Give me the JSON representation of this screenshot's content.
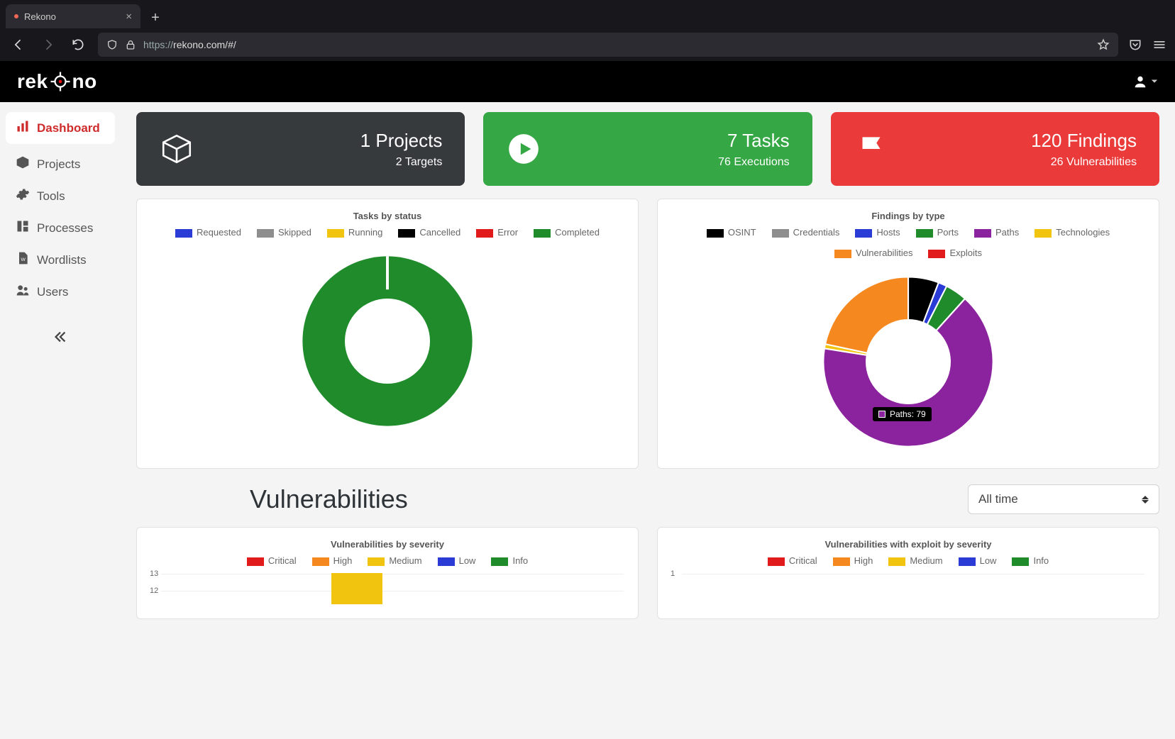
{
  "browser": {
    "tab_title": "Rekono",
    "url_scheme": "https://",
    "url_rest": "rekono.com/#/"
  },
  "brand": {
    "name_pre": "rek",
    "name_post": "no"
  },
  "sidebar": {
    "items": [
      {
        "label": "Dashboard",
        "icon": "bar-chart-icon",
        "active": true
      },
      {
        "label": "Projects",
        "icon": "cube-icon",
        "active": false
      },
      {
        "label": "Tools",
        "icon": "gear-icon",
        "active": false
      },
      {
        "label": "Processes",
        "icon": "grid-icon",
        "active": false
      },
      {
        "label": "Wordlists",
        "icon": "file-icon",
        "active": false
      },
      {
        "label": "Users",
        "icon": "users-icon",
        "active": false
      }
    ]
  },
  "stat_cards": [
    {
      "icon": "cube-icon",
      "primary": "1 Projects",
      "secondary": "2 Targets",
      "color": "#373a3d"
    },
    {
      "icon": "play-icon",
      "primary": "7 Tasks",
      "secondary": "76 Executions",
      "color": "#35a744"
    },
    {
      "icon": "flag-icon",
      "primary": "120 Findings",
      "secondary": "26 Vulnerabilities",
      "color": "#ea3a3a"
    }
  ],
  "tasks_chart": {
    "title": "Tasks by status",
    "legend": [
      {
        "label": "Requested",
        "color": "#2a3bd6"
      },
      {
        "label": "Skipped",
        "color": "#8e8e8e"
      },
      {
        "label": "Running",
        "color": "#f1c40f"
      },
      {
        "label": "Cancelled",
        "color": "#000000"
      },
      {
        "label": "Error",
        "color": "#e11b1b"
      },
      {
        "label": "Completed",
        "color": "#1f8b2b"
      }
    ]
  },
  "findings_chart": {
    "title": "Findings by type",
    "legend": [
      {
        "label": "OSINT",
        "color": "#000000"
      },
      {
        "label": "Credentials",
        "color": "#8e8e8e"
      },
      {
        "label": "Hosts",
        "color": "#2a3bd6"
      },
      {
        "label": "Ports",
        "color": "#1f8b2b"
      },
      {
        "label": "Paths",
        "color": "#8b239e"
      },
      {
        "label": "Technologies",
        "color": "#f1c40f"
      },
      {
        "label": "Vulnerabilities",
        "color": "#f5881f"
      },
      {
        "label": "Exploits",
        "color": "#e11b1b"
      }
    ],
    "tooltip": "Paths: 79"
  },
  "vuln_section": {
    "title": "Vulnerabilities",
    "time_filter": "All time"
  },
  "vuln_severity_chart": {
    "title": "Vulnerabilities by severity",
    "legend": [
      {
        "label": "Critical",
        "color": "#e11b1b"
      },
      {
        "label": "High",
        "color": "#f5881f"
      },
      {
        "label": "Medium",
        "color": "#f1c40f"
      },
      {
        "label": "Low",
        "color": "#2a3bd6"
      },
      {
        "label": "Info",
        "color": "#1f8b2b"
      }
    ],
    "yticks": [
      "13",
      "12"
    ]
  },
  "vuln_exploit_chart": {
    "title": "Vulnerabilities with exploit by severity",
    "legend": [
      {
        "label": "Critical",
        "color": "#e11b1b"
      },
      {
        "label": "High",
        "color": "#f5881f"
      },
      {
        "label": "Medium",
        "color": "#f1c40f"
      },
      {
        "label": "Low",
        "color": "#2a3bd6"
      },
      {
        "label": "Info",
        "color": "#1f8b2b"
      }
    ],
    "yticks": [
      "1"
    ]
  },
  "chart_data": [
    {
      "type": "pie",
      "title": "Tasks by status",
      "series": [
        {
          "name": "Requested",
          "value": 0
        },
        {
          "name": "Skipped",
          "value": 0
        },
        {
          "name": "Running",
          "value": 0
        },
        {
          "name": "Cancelled",
          "value": 0
        },
        {
          "name": "Error",
          "value": 0
        },
        {
          "name": "Completed",
          "value": 76
        }
      ]
    },
    {
      "type": "pie",
      "title": "Findings by type",
      "series": [
        {
          "name": "OSINT",
          "value": 7
        },
        {
          "name": "Credentials",
          "value": 0
        },
        {
          "name": "Hosts",
          "value": 2
        },
        {
          "name": "Ports",
          "value": 5
        },
        {
          "name": "Paths",
          "value": 79
        },
        {
          "name": "Technologies",
          "value": 1
        },
        {
          "name": "Vulnerabilities",
          "value": 26
        },
        {
          "name": "Exploits",
          "value": 0
        }
      ]
    },
    {
      "type": "bar",
      "title": "Vulnerabilities by severity",
      "categories": [
        "Critical",
        "High",
        "Medium",
        "Low",
        "Info"
      ],
      "values": [
        0,
        0,
        13,
        0,
        0
      ],
      "ylim": [
        0,
        13
      ]
    },
    {
      "type": "bar",
      "title": "Vulnerabilities with exploit by severity",
      "categories": [
        "Critical",
        "High",
        "Medium",
        "Low",
        "Info"
      ],
      "values": [
        0,
        0,
        0,
        0,
        0
      ],
      "ylim": [
        0,
        1
      ]
    }
  ]
}
